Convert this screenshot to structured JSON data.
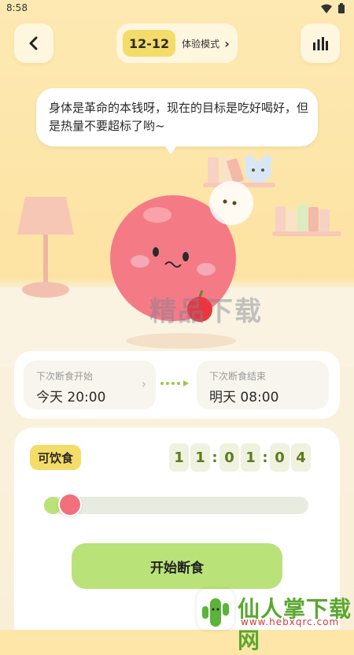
{
  "status_bar": {
    "time": "8:58",
    "icons": "▾ ▮"
  },
  "header": {
    "back_icon": "chevron-left-icon",
    "mode_badge": "12-12",
    "mode_label": "体验模式",
    "mode_arrow": "›",
    "stats_icon": "bar-chart-icon"
  },
  "bubble": {
    "text": "身体是革命的本钱呀，现在的目标是吃好喝好，但是热量不要超标了哟~"
  },
  "next_fast": {
    "start_label": "下次断食开始",
    "start_value": "今天 20:00",
    "start_chevron": "›",
    "end_label": "下次断食结束",
    "end_value": "明天 08:00"
  },
  "timer_panel": {
    "status": "可饮食",
    "digits": [
      "1",
      "1",
      "0",
      "1",
      "0",
      "4"
    ],
    "progress": 0.04,
    "start_button": "开始断食"
  },
  "watermarks": {
    "center": "精品下载",
    "brand": "仙人掌下载网",
    "url": "www.hebxqrc.com"
  },
  "colors": {
    "accent_yellow": "#f3dc6a",
    "accent_green": "#b9e278",
    "character_pink": "#f2707e"
  }
}
